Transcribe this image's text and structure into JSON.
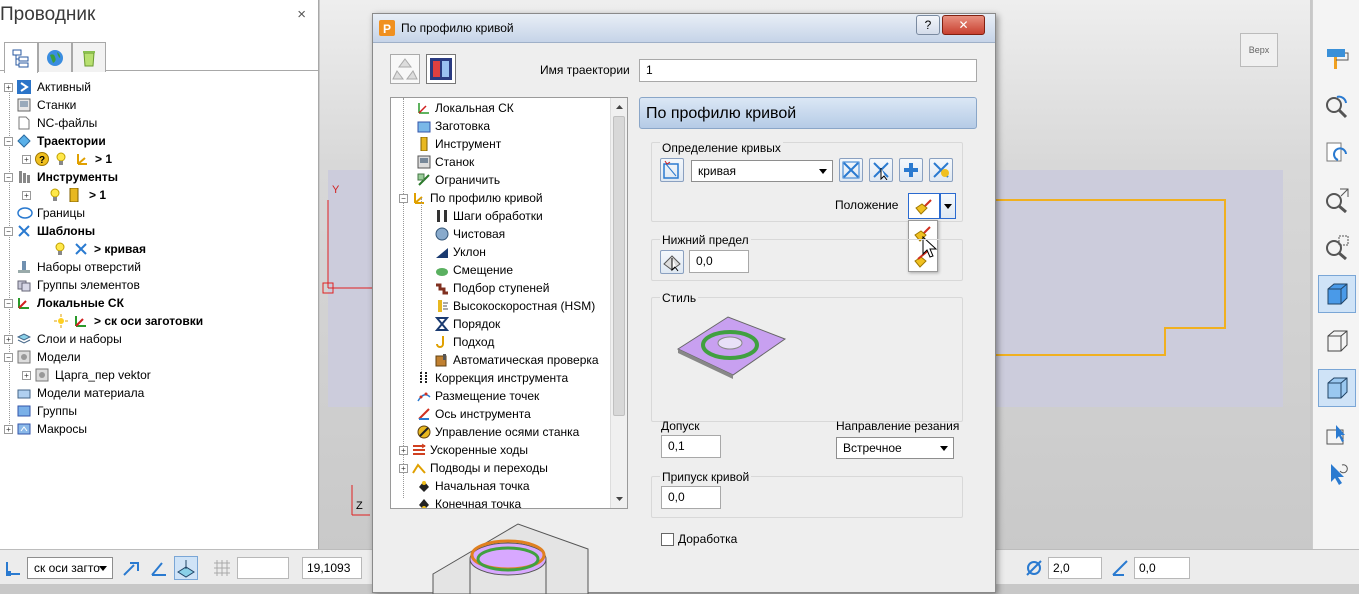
{
  "explorer": {
    "title": "Проводник",
    "close": "×",
    "items": [
      {
        "label": "Активный"
      },
      {
        "label": "Станки"
      },
      {
        "label": "NC-файлы"
      },
      {
        "label": "Траектории"
      },
      {
        "label": "> 1"
      },
      {
        "label": "Инструменты"
      },
      {
        "label": "> 1"
      },
      {
        "label": "Границы"
      },
      {
        "label": "Шаблоны"
      },
      {
        "label": "> кривая"
      },
      {
        "label": "Наборы отверстий"
      },
      {
        "label": "Группы элементов"
      },
      {
        "label": "Локальные СК"
      },
      {
        "label": "> ск оси заготовки"
      },
      {
        "label": "Слои и наборы"
      },
      {
        "label": "Модели"
      },
      {
        "label": "Царга_пер vektor"
      },
      {
        "label": "Модели материала"
      },
      {
        "label": "Группы"
      },
      {
        "label": "Макросы"
      }
    ]
  },
  "viewport": {
    "view_label": "Верх",
    "axis_y": "Y",
    "axis_z": "Z"
  },
  "dialog": {
    "title": "По профилю кривой",
    "help": "?",
    "close": "✕",
    "traj_name_label": "Имя траектории",
    "traj_name_value": "1",
    "tree": [
      {
        "label": "Локальная СК"
      },
      {
        "label": "Заготовка"
      },
      {
        "label": "Инструмент"
      },
      {
        "label": "Станок"
      },
      {
        "label": "Ограничить"
      },
      {
        "label": "По профилю кривой"
      },
      {
        "label": "Шаги обработки"
      },
      {
        "label": "Чистовая"
      },
      {
        "label": "Уклон"
      },
      {
        "label": "Смещение"
      },
      {
        "label": "Подбор ступеней"
      },
      {
        "label": "Высокоскоростная (HSM)"
      },
      {
        "label": "Порядок"
      },
      {
        "label": "Подход"
      },
      {
        "label": "Автоматическая проверка"
      },
      {
        "label": "Коррекция инструмента"
      },
      {
        "label": "Размещение точек"
      },
      {
        "label": "Ось инструмента"
      },
      {
        "label": "Управление осями станка"
      },
      {
        "label": "Ускоренные ходы"
      },
      {
        "label": "Подводы и переходы"
      },
      {
        "label": "Начальная точка"
      },
      {
        "label": "Конечная точка"
      }
    ],
    "panel_title": "По профилю кривой",
    "curve_def_label": "Определение кривых",
    "curve_select": "кривая",
    "position_label": "Положение",
    "lower_limit_label": "Нижний предел",
    "lower_limit_value": "0,0",
    "style_label": "Стиль",
    "tolerance_label": "Допуск",
    "tolerance_value": "0,1",
    "cut_dir_label": "Направление резания",
    "cut_dir_value": "Встречное",
    "curve_allowance_label": "Припуск кривой",
    "curve_allowance_value": "0,0",
    "rework_label": "Доработка"
  },
  "statusbar": {
    "workplane_select": "ск оси загто",
    "coord_value": "19,1093",
    "dia_value": "2,0",
    "angle_value": "0,0"
  }
}
